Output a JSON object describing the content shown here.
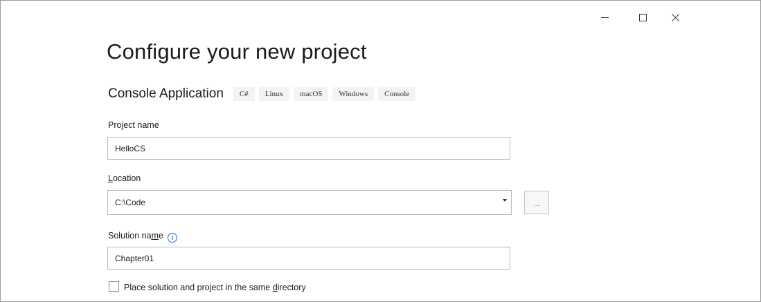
{
  "window": {
    "minimize_glyph": "–",
    "maximize_glyph": "☐",
    "close_glyph": "✕"
  },
  "title": "Configure your new project",
  "template": {
    "name": "Console Application",
    "tags": [
      "C#",
      "Linux",
      "macOS",
      "Windows",
      "Console"
    ]
  },
  "project_name": {
    "label": "Project name",
    "value": "HelloCS"
  },
  "location": {
    "label_prefix": "",
    "label_accel": "L",
    "label_rest": "ocation",
    "value": "C:\\Code",
    "browse_label": "..."
  },
  "solution_name": {
    "label_main": "Solution na",
    "label_accel": "m",
    "label_rest": "e",
    "info_icon": "i",
    "value": "Chapter01"
  },
  "same_directory": {
    "checked": false,
    "label_main": "Place solution and project in the same ",
    "label_accel": "d",
    "label_rest": "irectory"
  },
  "colors": {
    "accent": "#1f6fc5",
    "border": "#b8b8b8"
  }
}
